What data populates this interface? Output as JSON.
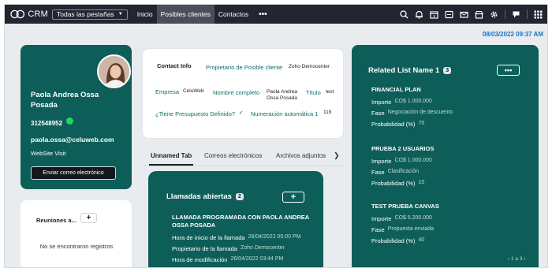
{
  "topbar": {
    "app_name": "CRM",
    "tabs_select": "Todas las pestañas",
    "nav": [
      "Inicio",
      "Posibles clientes",
      "Contactos"
    ],
    "more": "•••",
    "active_nav": "Posibles clientes"
  },
  "datetime": "08/03/2022 09:37 AM",
  "profile": {
    "name": "Paola Andrea Ossa Posada",
    "phone": "312548952",
    "email": "paola.ossa@celuweb.com",
    "website": "WebSite Visit",
    "button": "Enviar correo electrónico"
  },
  "meetings": {
    "title": "Reuniones a...",
    "plus": "+",
    "empty": "No se encontraron registros"
  },
  "contact_info": {
    "heading": "Contact Info",
    "owner_label": "Propietario de Posible cliente",
    "owner_value": "Zoho Democenter",
    "company_label": "Empresa",
    "company_value": "CeluWeb",
    "fullname_label": "Nombre completo",
    "fullname_value": "Paola Andrea Ossa Posada",
    "title_label": "Título",
    "title_value": "test",
    "budget_label": "¿Tiene Presupuesto Definido?",
    "budget_value": "✓",
    "autonum_label": "Numeración automática 1",
    "autonum_value": "119"
  },
  "tabs": {
    "items": [
      "Unnamed Tab",
      "Correos electrónicos",
      "Archivos adjuntos"
    ],
    "arrow": "❯"
  },
  "calls": {
    "title": "Llamadas abiertas",
    "count": "2",
    "plus": "+",
    "subject": "LLAMADA PROGRAMADA CON PAOLA ANDREA OSSA POSADA",
    "rows": [
      {
        "label": "Hora de inicio de la llamada",
        "value": "26/04/2022 05:00 PM"
      },
      {
        "label": "Propietario de la llamada",
        "value": "Zoho Democenter"
      },
      {
        "label": "Hora de modificación",
        "value": "26/04/2022 03:44 PM"
      }
    ]
  },
  "related": {
    "title": "Related List Name 1",
    "count": "3",
    "more": "•••",
    "sections": [
      {
        "name": "FINANCIAL PLAN",
        "rows": [
          {
            "label": "Importe",
            "value": "CO$ 1.000.000"
          },
          {
            "label": "Fase",
            "value": "Negociación de descuento"
          },
          {
            "label": "Probabilidad (%)",
            "value": "70"
          }
        ]
      },
      {
        "name": "PRUEBA 2 USUARIOS",
        "rows": [
          {
            "label": "Importe",
            "value": "CO$ 1.000.000"
          },
          {
            "label": "Fase",
            "value": "Clasificación"
          },
          {
            "label": "Probabilidad (%)",
            "value": "10"
          }
        ]
      },
      {
        "name": "TEST PRUEBA CANVAS",
        "rows": [
          {
            "label": "Importe",
            "value": "CO$ 5.200.000"
          },
          {
            "label": "Fase",
            "value": "Propuesta enviada"
          },
          {
            "label": "Probabilidad (%)",
            "value": "40"
          }
        ]
      }
    ],
    "pagination": "1 a 3"
  },
  "colors": {
    "topbar": "#23252f",
    "card_teal": "#0d5e58",
    "link_blue": "#1a73c6",
    "label_teal": "#0e6e6a"
  },
  "icons": [
    "crm-logo-icon",
    "search-icon",
    "bell-icon",
    "calendar-icon",
    "activity-icon",
    "mail-icon",
    "store-icon",
    "gear-icon",
    "feedback-icon",
    "apps-grid-icon"
  ]
}
